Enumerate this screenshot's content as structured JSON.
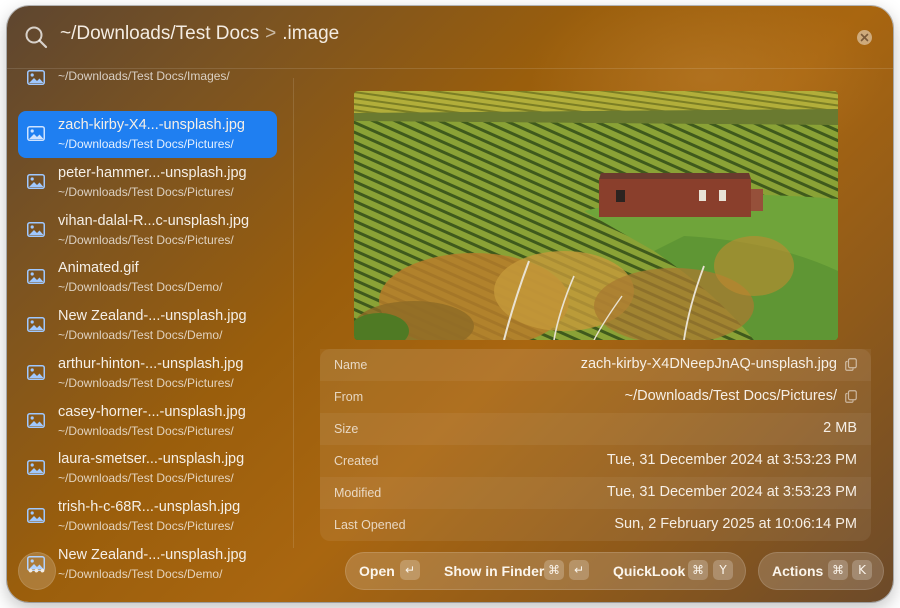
{
  "search": {
    "path": "~/Downloads/Test Docs",
    "separator": ">",
    "query": ".image"
  },
  "results": [
    {
      "title": "",
      "path": "~/Downloads/Test Docs/Images/"
    },
    {
      "title": "zach-kirby-X4...-unsplash.jpg",
      "path": "~/Downloads/Test Docs/Pictures/"
    },
    {
      "title": "peter-hammer...-unsplash.jpg",
      "path": "~/Downloads/Test Docs/Pictures/"
    },
    {
      "title": "vihan-dalal-R...c-unsplash.jpg",
      "path": "~/Downloads/Test Docs/Pictures/"
    },
    {
      "title": "Animated.gif",
      "path": "~/Downloads/Test Docs/Demo/"
    },
    {
      "title": "New Zealand-...-unsplash.jpg",
      "path": "~/Downloads/Test Docs/Demo/"
    },
    {
      "title": "arthur-hinton-...-unsplash.jpg",
      "path": "~/Downloads/Test Docs/Pictures/"
    },
    {
      "title": "casey-horner-...-unsplash.jpg",
      "path": "~/Downloads/Test Docs/Pictures/"
    },
    {
      "title": "laura-smetser...-unsplash.jpg",
      "path": "~/Downloads/Test Docs/Pictures/"
    },
    {
      "title": "trish-h-c-68R...-unsplash.jpg",
      "path": "~/Downloads/Test Docs/Pictures/"
    },
    {
      "title": "New Zealand-...-unsplash.jpg",
      "path": "~/Downloads/Test Docs/Demo/"
    }
  ],
  "selected_index": 1,
  "details": {
    "name_label": "Name",
    "name_value": "zach-kirby-X4DNeepJnAQ-unsplash.jpg",
    "from_label": "From",
    "from_value": "~/Downloads/Test Docs/Pictures/",
    "size_label": "Size",
    "size_value": "2 MB",
    "created_label": "Created",
    "created_value": "Tue, 31 December 2024 at 3:53:23 PM",
    "modified_label": "Modified",
    "modified_value": "Tue, 31 December 2024 at 3:53:23 PM",
    "opened_label": "Last Opened",
    "opened_value": "Sun, 2 February 2025 at 10:06:14 PM"
  },
  "footer": {
    "more_label": "•••",
    "open_label": "Open",
    "open_key": "↵",
    "finder_label": "Show in Finder",
    "finder_key1": "⌘",
    "finder_key2": "↵",
    "quicklook_label": "QuickLook",
    "quicklook_key1": "⌘",
    "quicklook_key2": "Y",
    "actions_label": "Actions",
    "actions_key1": "⌘",
    "actions_key2": "K"
  },
  "icons": {
    "search": "search-icon",
    "clear": "close-circle-icon",
    "image": "image-file-icon",
    "copy": "copy-icon",
    "more": "ellipsis-icon",
    "return": "return-key-icon",
    "command": "command-key-icon"
  },
  "colors": {
    "selection": "#1f7ff1",
    "window_tint": "#9a5e0c"
  }
}
